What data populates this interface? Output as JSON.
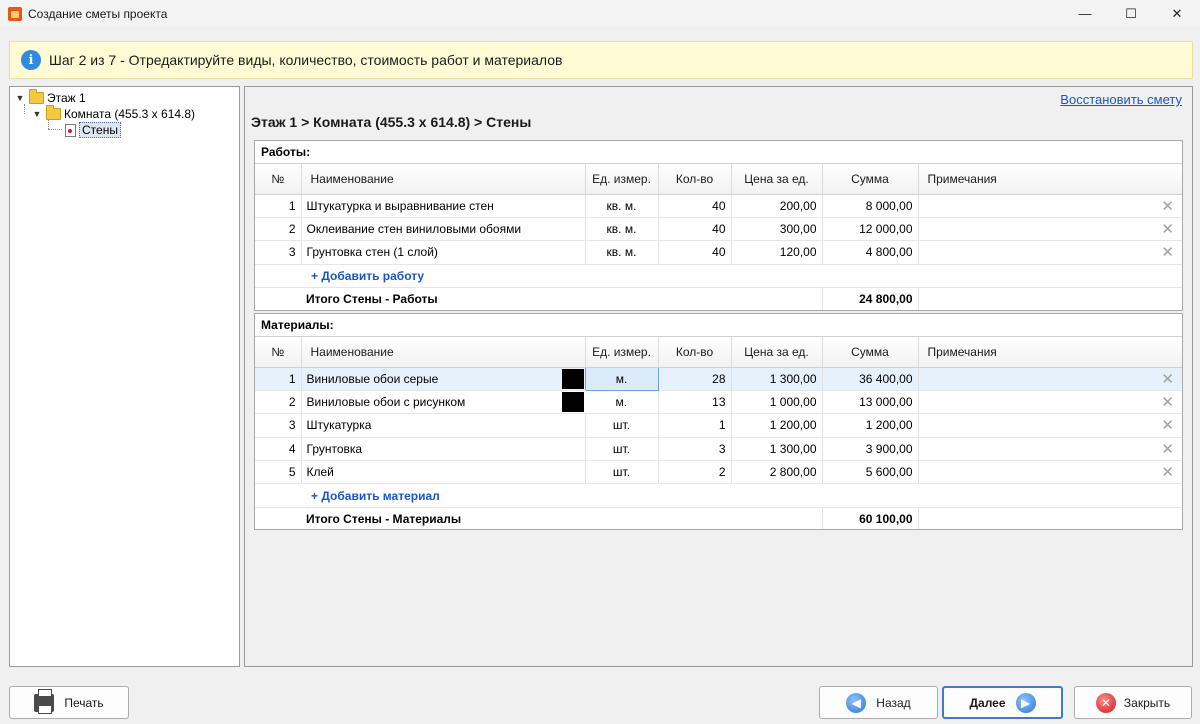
{
  "window": {
    "title": "Создание сметы проекта",
    "controls": [
      "—",
      "☐",
      "✕"
    ]
  },
  "banner": {
    "text": "Шаг 2 из 7 - Отредактируйте виды, количество, стоимость работ и материалов"
  },
  "tree": {
    "floor": "Этаж 1",
    "room": "Комната (455.3 x 614.8)",
    "walls": "Стены"
  },
  "content": {
    "restore_link": "Восстановить смету",
    "breadcrumb": "Этаж 1 > Комната (455.3 x 614.8) > Стены"
  },
  "columns": {
    "no": "№",
    "name": "Наименование",
    "unit": "Ед. измер.",
    "qty": "Кол-во",
    "price": "Цена за ед.",
    "sum": "Сумма",
    "notes": "Примечания"
  },
  "works": {
    "title": "Работы:",
    "rows": [
      {
        "no": "1",
        "name": "Штукатурка и выравнивание стен",
        "unit": "кв. м.",
        "qty": "40",
        "price": "200,00",
        "sum": "8 000,00",
        "note": ""
      },
      {
        "no": "2",
        "name": "Оклеивание стен виниловыми обоями",
        "unit": "кв. м.",
        "qty": "40",
        "price": "300,00",
        "sum": "12 000,00",
        "note": ""
      },
      {
        "no": "3",
        "name": "Грунтовка стен (1 слой)",
        "unit": "кв. м.",
        "qty": "40",
        "price": "120,00",
        "sum": "4 800,00",
        "note": ""
      }
    ],
    "add_label": "+ Добавить работу",
    "total_label": "Итого Стены - Работы",
    "total_value": "24 800,00"
  },
  "materials": {
    "title": "Материалы:",
    "rows": [
      {
        "no": "1",
        "name": "Виниловые обои серые",
        "unit": "м.",
        "qty": "28",
        "price": "1 300,00",
        "sum": "36 400,00",
        "note": ""
      },
      {
        "no": "2",
        "name": "Виниловые обои с рисунком",
        "unit": "м.",
        "qty": "13",
        "price": "1 000,00",
        "sum": "13 000,00",
        "note": ""
      },
      {
        "no": "3",
        "name": "Штукатурка",
        "unit": "шт.",
        "qty": "1",
        "price": "1 200,00",
        "sum": "1 200,00",
        "note": ""
      },
      {
        "no": "4",
        "name": "Грунтовка",
        "unit": "шт.",
        "qty": "3",
        "price": "1 300,00",
        "sum": "3 900,00",
        "note": ""
      },
      {
        "no": "5",
        "name": "Клей",
        "unit": "шт.",
        "qty": "2",
        "price": "2 800,00",
        "sum": "5 600,00",
        "note": ""
      }
    ],
    "add_label": "+ Добавить материал",
    "total_label": "Итого Стены - Материалы",
    "total_value": "60 100,00"
  },
  "buttons": {
    "print": "Печать",
    "back": "Назад",
    "next": "Далее",
    "close": "Закрыть"
  },
  "icons": {
    "delete_glyph": "✕"
  },
  "colors": {
    "banner_bg": "#fffcd5",
    "link": "#1a56c8",
    "selected_row": "#e6f1fb",
    "primary_border": "#3a7bd5"
  }
}
